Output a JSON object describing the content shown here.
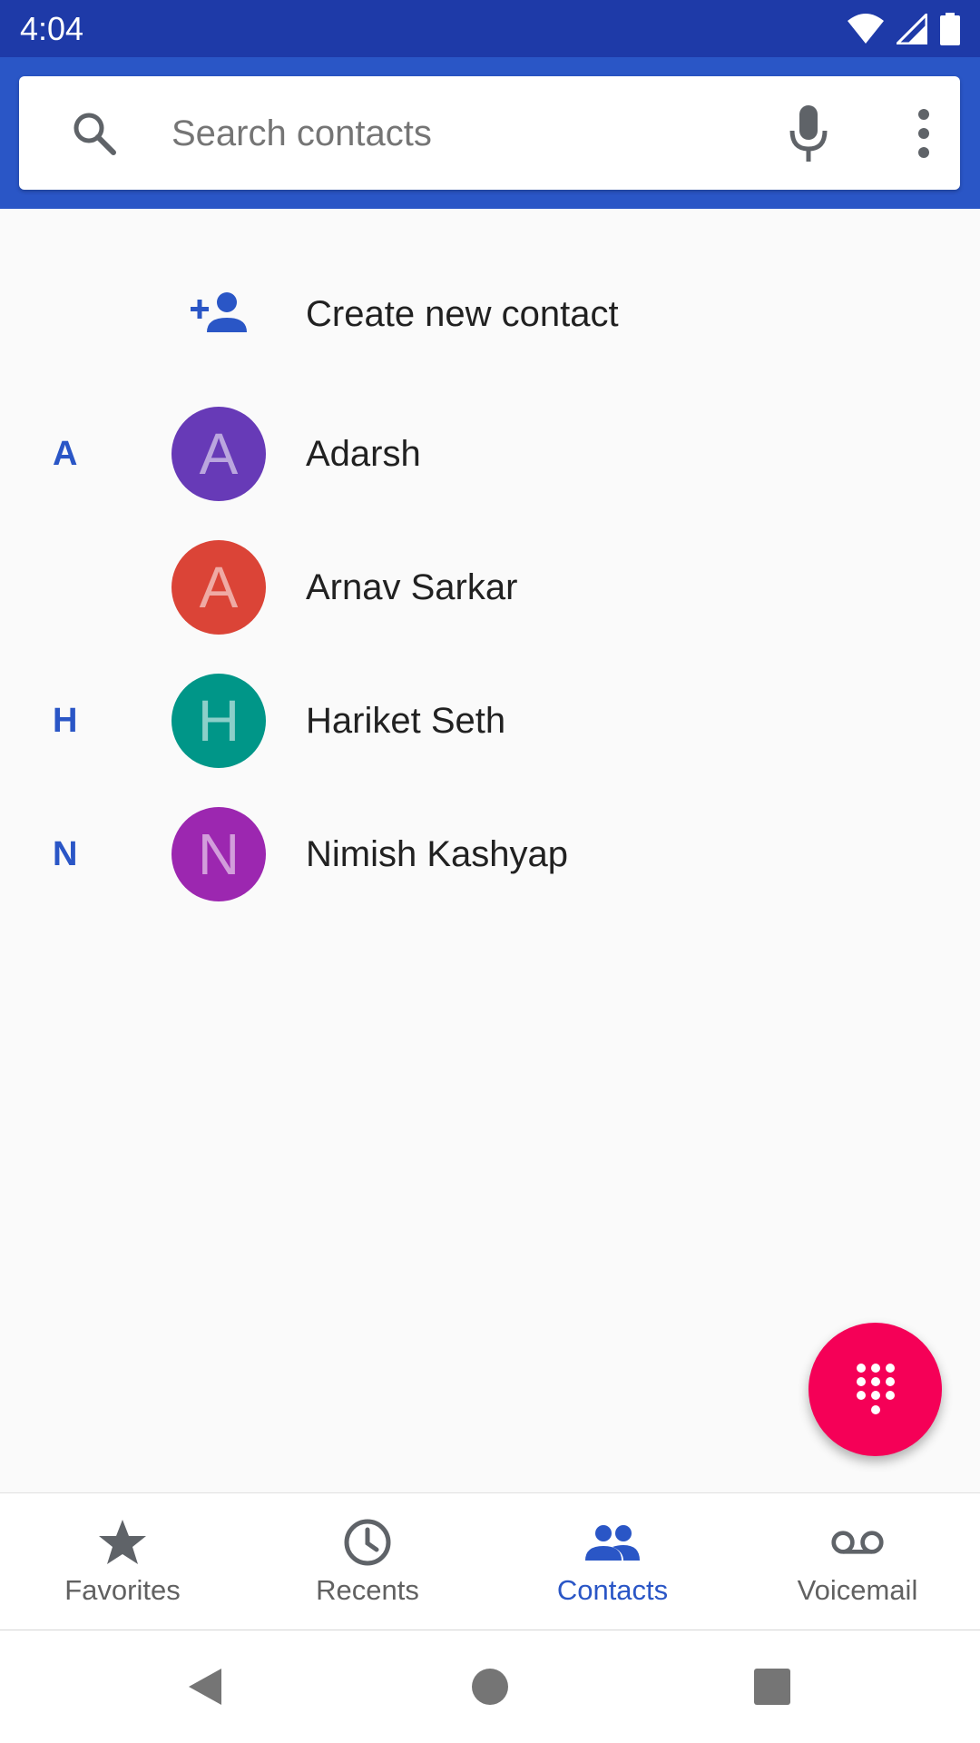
{
  "status_bar": {
    "time": "4:04",
    "icons": [
      "wifi-icon",
      "signal-icon",
      "battery-icon"
    ]
  },
  "search": {
    "placeholder": "Search contacts",
    "value": "",
    "icons": [
      "search-icon",
      "mic-icon",
      "more-vert-icon"
    ]
  },
  "create_contact": {
    "label": "Create new contact",
    "icon": "add-person-icon"
  },
  "contacts": [
    {
      "section": "A",
      "initial": "A",
      "name": "Adarsh",
      "avatar_color": "#673ab7"
    },
    {
      "section": "",
      "initial": "A",
      "name": "Arnav Sarkar",
      "avatar_color": "#db4437"
    },
    {
      "section": "H",
      "initial": "H",
      "name": "Hariket Seth",
      "avatar_color": "#009688"
    },
    {
      "section": "N",
      "initial": "N",
      "name": "Nimish Kashyap",
      "avatar_color": "#9c27b0"
    }
  ],
  "fab": {
    "icon": "dialpad-icon",
    "color": "#f50057"
  },
  "bottom_nav": {
    "items": [
      {
        "label": "Favorites",
        "icon": "star-icon",
        "active": false
      },
      {
        "label": "Recents",
        "icon": "clock-icon",
        "active": false
      },
      {
        "label": "Contacts",
        "icon": "people-icon",
        "active": true
      },
      {
        "label": "Voicemail",
        "icon": "voicemail-icon",
        "active": false
      }
    ]
  },
  "system_nav": [
    "back-icon",
    "home-icon",
    "recents-square-icon"
  ],
  "colors": {
    "status_bar": "#1e3aa8",
    "app_bar": "#2a56c6",
    "accent": "#2a56c6",
    "background": "#fafafa"
  }
}
